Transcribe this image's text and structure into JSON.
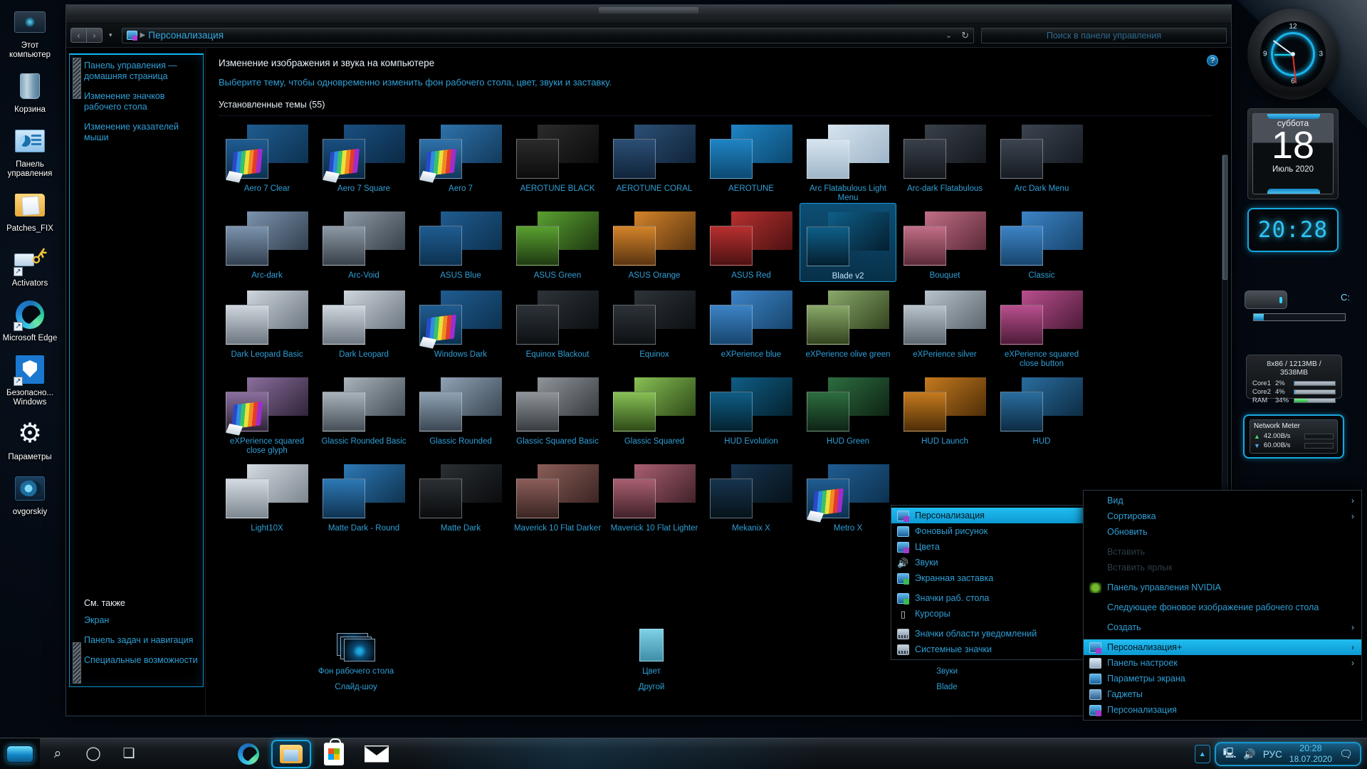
{
  "desktop": {
    "icons": [
      {
        "name": "Этот компьютер",
        "icon": "this-pc-icon"
      },
      {
        "name": "Корзина",
        "icon": "recycle-bin-icon"
      },
      {
        "name": "Панель управления",
        "icon": "control-panel-icon"
      },
      {
        "name": "Patches_FIX",
        "icon": "folder-icon"
      },
      {
        "name": "Activators",
        "icon": "key-icon"
      },
      {
        "name": "Microsoft Edge",
        "icon": "edge-icon"
      },
      {
        "name": "Безопасно... Windows",
        "icon": "windows-security-icon"
      },
      {
        "name": "Параметры",
        "icon": "settings-gear-icon"
      },
      {
        "name": "ovgorskiy",
        "icon": "ovgorskiy-icon"
      }
    ]
  },
  "window": {
    "address": "Персонализация",
    "search_placeholder": "Поиск в панели управления",
    "nav": {
      "back": "‹",
      "forward": "›",
      "history": "▾",
      "refresh": "↻",
      "chevron": "⌄"
    },
    "help": "?"
  },
  "sidebar": {
    "links": [
      "Панель управления — домашняя страница",
      "Изменение значков рабочего стола",
      "Изменение указателей мыши"
    ],
    "see_also_title": "См. также",
    "see_also": [
      "Экран",
      "Панель задач и навигация",
      "Специальные возможности"
    ]
  },
  "content": {
    "heading": "Изменение изображения и звука на компьютере",
    "subheading": "Выберите тему, чтобы одновременно изменить фон рабочего стола, цвет, звуки и заставку.",
    "themes_count_label": "Установленные темы (55)",
    "selected_theme": "Blade v2",
    "themes": [
      [
        "Aero 7 Clear",
        "Aero 7 Square",
        "Aero 7",
        "AEROTUNE BLACK",
        "AEROTUNE CORAL",
        "AEROTUNE",
        "Arc Flatabulous Light Menu",
        "Arc-dark Flatabulous",
        "Arc Dark Menu"
      ],
      [
        "Arc-dark",
        "Arc-Void",
        "ASUS Blue",
        "ASUS Green",
        "ASUS Orange",
        "ASUS Red",
        "Blade v2",
        "Bouquet",
        "Classic"
      ],
      [
        "Dark Leopard Basic",
        "Dark Leopard",
        "Windows Dark",
        "Equinox Blackout",
        "Equinox",
        "eXPerience blue",
        "eXPerience olive green",
        "eXPerience silver",
        "eXPerience squared close button"
      ],
      [
        "eXPerience squared close glyph",
        "Glassic Rounded Basic",
        "Glassic Rounded",
        "Glassic Squared Basic",
        "Glassic Squared",
        "HUD Evolution",
        "HUD Green",
        "HUD Launch",
        "HUD"
      ],
      [
        "Light10X",
        "Matte Dark - Round",
        "Matte Dark",
        "Maverick 10 Flat Darker",
        "Maverick 10 Flat Lighter",
        "Mekanix X",
        "Metro X",
        "",
        ""
      ]
    ],
    "bottom": [
      {
        "title": "Фон рабочего стола",
        "value": "Слайд-шоу",
        "icon": "slideshow-icon"
      },
      {
        "title": "Цвет",
        "value": "Другой",
        "icon": "color-swatch-icon"
      },
      {
        "title": "Звуки",
        "value": "Blade",
        "icon": "sound-icon"
      }
    ]
  },
  "context_menu_left": {
    "items": [
      {
        "label": "Персонализация",
        "icon": "personalization-icon",
        "selected": true
      },
      {
        "label": "Фоновый рисунок",
        "icon": "wallpaper-icon"
      },
      {
        "label": "Цвета",
        "icon": "colors-icon"
      },
      {
        "label": "Звуки",
        "icon": "sounds-icon"
      },
      {
        "label": "Экранная заставка",
        "icon": "screensaver-icon"
      },
      {
        "sep": true
      },
      {
        "label": "Значки раб. стола",
        "icon": "desktop-icons-icon"
      },
      {
        "label": "Курсоры",
        "icon": "cursors-icon"
      },
      {
        "sep": true
      },
      {
        "label": "Значки области уведомлений",
        "icon": "tray-icons-icon"
      },
      {
        "label": "Системные значки",
        "icon": "system-icons-icon"
      }
    ]
  },
  "context_menu_right": {
    "items": [
      {
        "label": "Вид",
        "arrow": "›"
      },
      {
        "label": "Сортировка",
        "arrow": "›"
      },
      {
        "label": "Обновить"
      },
      {
        "sep": true
      },
      {
        "label": "Вставить",
        "disabled": true
      },
      {
        "label": "Вставить ярлык",
        "disabled": true
      },
      {
        "sep": true
      },
      {
        "label": "Панель управления NVIDIA",
        "icon": "nvidia-icon"
      },
      {
        "sep": true
      },
      {
        "label": "Следующее фоновое изображение рабочего стола"
      },
      {
        "sep": true
      },
      {
        "label": "Создать",
        "arrow": "›"
      },
      {
        "sep": true
      },
      {
        "label": "Персонализация+",
        "icon": "personalization-plus-icon",
        "arrow": "›",
        "selected": true
      },
      {
        "label": "Панель настроек",
        "icon": "settings-panel-icon",
        "arrow": "›"
      },
      {
        "label": "Параметры экрана",
        "icon": "display-settings-icon"
      },
      {
        "label": "Гаджеты",
        "icon": "gadgets-icon"
      },
      {
        "label": "Персонализация",
        "icon": "personalization-icon"
      }
    ]
  },
  "gadgets": {
    "calendar": {
      "weekday": "суббота",
      "day": "18",
      "month_year": "Июль 2020"
    },
    "digital_clock": "20:28",
    "drive": {
      "letter": "C:",
      "used_percent": 11
    },
    "system_monitor": {
      "header": "8x86 / 1213MB / 3538MB",
      "rows": [
        {
          "label": "Core1",
          "value": "2%",
          "percent": 2,
          "color": "#5aa9e0"
        },
        {
          "label": "Core2",
          "value": "4%",
          "percent": 4,
          "color": "#5aa9e0"
        },
        {
          "label": "RAM",
          "value": "34%",
          "percent": 34,
          "color": "#46d264"
        }
      ]
    },
    "network": {
      "title": "Network Meter",
      "up": "42.00B/s",
      "down": "60.00B/s"
    }
  },
  "taskbar": {
    "start": "start-button",
    "buttons": [
      {
        "name": "search-icon",
        "glyph": "⌕"
      },
      {
        "name": "cortana-icon",
        "glyph": "◯"
      },
      {
        "name": "task-view-icon",
        "glyph": "❏"
      }
    ],
    "apps": [
      {
        "name": "edge-taskbar-icon",
        "active": false
      },
      {
        "name": "file-explorer-taskbar-icon",
        "active": true
      },
      {
        "name": "microsoft-store-taskbar-icon",
        "active": false
      },
      {
        "name": "mail-taskbar-icon",
        "active": false
      }
    ],
    "tray": {
      "expand": "▲",
      "network": "🖵",
      "volume": "◁))",
      "language": "РУС",
      "time": "20:28",
      "date": "18.07.2020",
      "action_center": "▭"
    }
  },
  "colors": {
    "accent": "#2f9fd6",
    "accent_bright": "#16a8e0",
    "selection": "#21bdf0",
    "window_bg": "#000000",
    "text": "#e9f1f8"
  }
}
